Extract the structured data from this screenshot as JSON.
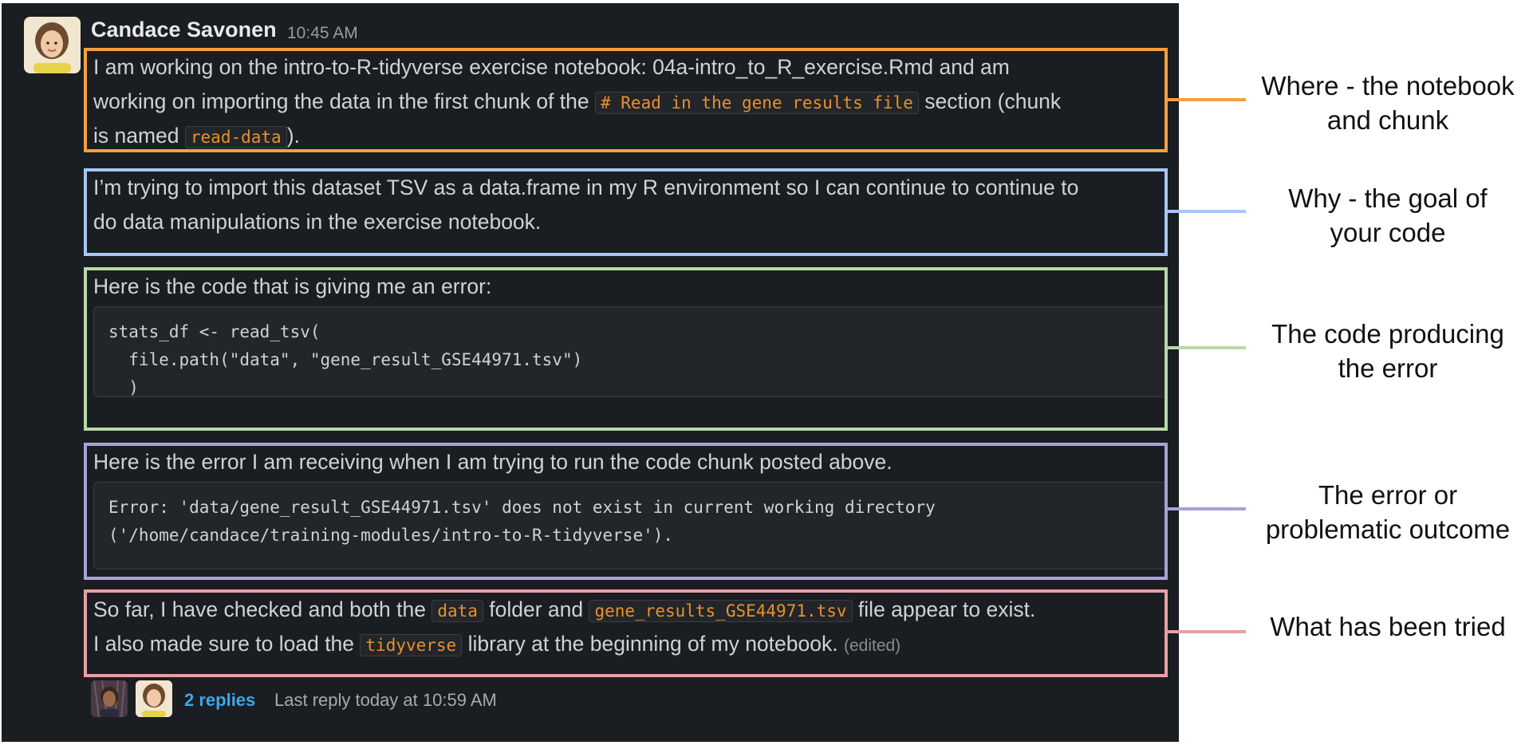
{
  "message": {
    "sender": "Candace Savonen",
    "time": "10:45 AM"
  },
  "where": {
    "line1": "I am working on the intro-to-R-tidyverse exercise notebook: 04a-intro_to_R_exercise.Rmd and am",
    "line2_before": "working on importing the data in the first chunk of the ",
    "line2_code": "# Read in the gene results file",
    "line2_after": " section (chunk",
    "line3_before": "is named ",
    "line3_code": "read-data",
    "line3_after": ")."
  },
  "why": {
    "line1": "I’m trying to import this dataset TSV as a data.frame in my R environment so I can continue to continue to",
    "line2": "do data manipulations in the exercise notebook."
  },
  "code": {
    "intro": "Here is the code that is giving me an error:",
    "lines": [
      "stats_df <- read_tsv(",
      "  file.path(\"data\", \"gene_result_GSE44971.tsv\")",
      "  )"
    ]
  },
  "error": {
    "intro": "Here is the error I am receiving when I am trying to run the code chunk posted above.",
    "lines": [
      "Error: 'data/gene_result_GSE44971.tsv' does not exist in current working directory",
      "('/home/candace/training-modules/intro-to-R-tidyverse')."
    ]
  },
  "tried": {
    "line1_before": "So far, I have checked and both the ",
    "line1_code1": "data",
    "line1_mid": " folder and ",
    "line1_code2": "gene_results_GSE44971.tsv",
    "line1_after": " file appear to exist.",
    "line2_before": "I also made sure to load the ",
    "line2_code": "tidyverse",
    "line2_after": " library at the beginning of my notebook. ",
    "edited": "(edited)"
  },
  "thread": {
    "replies": "2 replies",
    "last_reply": "Last reply today at 10:59 AM"
  },
  "annotations": {
    "where": [
      "Where - the notebook",
      "and chunk"
    ],
    "why": [
      "Why - the goal of",
      "your code"
    ],
    "code": [
      "The code producing",
      "the error"
    ],
    "error": [
      "The error or",
      "problematic outcome"
    ],
    "tried": [
      "What has been tried"
    ]
  },
  "colors": {
    "where": "#f5a03e",
    "why": "#a7c6f2",
    "code": "#b8d8a8",
    "error": "#a8a2d6",
    "tried": "#e8a0a2",
    "slack_background": "#1a1d21",
    "link": "#3da8e8",
    "inline_code": "#e8912d"
  },
  "icons": {
    "sender_avatar": "user-avatar-icon",
    "reply_avatar_1": "user-avatar-icon",
    "reply_avatar_2": "user-avatar-icon"
  }
}
